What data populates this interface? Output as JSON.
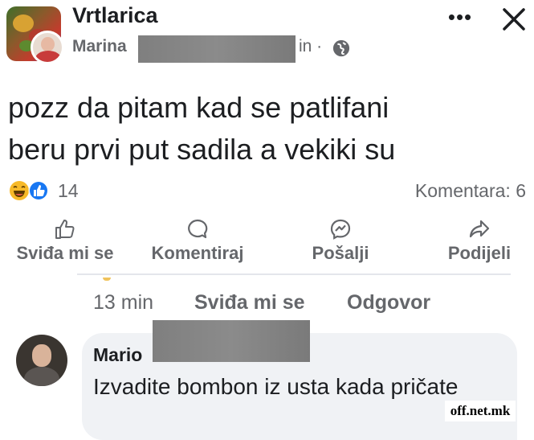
{
  "header": {
    "group_name": "Vrtlarica",
    "author_name": "Marina",
    "time_suffix": "in ·",
    "more_label": "•••"
  },
  "post": {
    "text_line1": "pozz da pitam kad se patlifani",
    "text_line2": "beru prvi put sadila a vekiki su"
  },
  "stats": {
    "reaction_count": "14",
    "comments": "Komentara: 6",
    "reaction_icons": [
      "laugh-react-icon",
      "like-react-icon"
    ]
  },
  "actions": {
    "like": "Sviđa mi se",
    "comment": "Komentiraj",
    "send": "Pošalji",
    "share": "Podijeli"
  },
  "comment_meta": {
    "time": "13 min",
    "like": "Sviđa mi se",
    "reply": "Odgovor"
  },
  "comment": {
    "author_visible": "Mario",
    "text": "Izvadite bombon iz usta kada pričate"
  },
  "watermark": "off.net.mk",
  "colors": {
    "like_blue": "#1877f2",
    "laugh_yellow": "#f7b928",
    "secondary_text": "#65676b"
  }
}
